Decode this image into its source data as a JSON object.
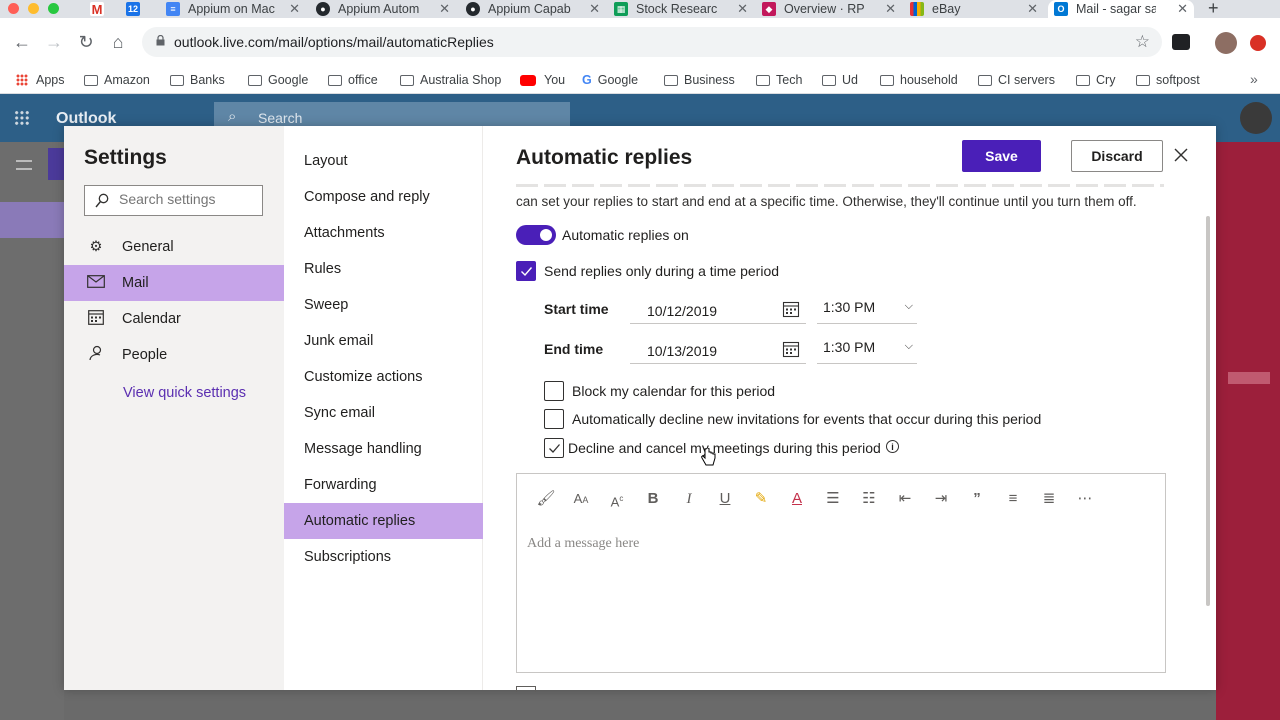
{
  "browser": {
    "tabs": [
      {
        "title": "",
        "icon": "gmail-icon"
      },
      {
        "title": "",
        "icon": "calendar-12-icon"
      },
      {
        "title": "Appium on Mac",
        "icon": "docs-icon"
      },
      {
        "title": "Appium Autom",
        "icon": "github-icon"
      },
      {
        "title": "Appium Capab",
        "icon": "github-icon"
      },
      {
        "title": "Stock Researc",
        "icon": "sheets-icon"
      },
      {
        "title": "Overview · RP",
        "icon": "rp-icon"
      },
      {
        "title": "eBay",
        "icon": "ebay-icon"
      },
      {
        "title": "Mail - sagar sa",
        "icon": "outlook-icon"
      }
    ],
    "url": "outlook.live.com/mail/options/mail/automaticReplies",
    "bookmarks": [
      "Apps",
      "Amazon",
      "Banks",
      "Google",
      "office",
      "Australia Shop",
      "You",
      "Google",
      "Business",
      "Tech",
      "Ud",
      "household",
      "CI servers",
      "Cry",
      "softpost"
    ]
  },
  "owa": {
    "brand": "Outlook",
    "search_placeholder": "Search"
  },
  "settings": {
    "title": "Settings",
    "search_placeholder": "Search settings",
    "categories": [
      {
        "label": "General",
        "icon": "gear-icon"
      },
      {
        "label": "Mail",
        "icon": "mail-icon"
      },
      {
        "label": "Calendar",
        "icon": "calendar-icon"
      },
      {
        "label": "People",
        "icon": "people-icon"
      }
    ],
    "view_quick": "View quick settings",
    "subitems": [
      "Layout",
      "Compose and reply",
      "Attachments",
      "Rules",
      "Sweep",
      "Junk email",
      "Customize actions",
      "Sync email",
      "Message handling",
      "Forwarding",
      "Automatic replies",
      "Subscriptions"
    ]
  },
  "auto": {
    "title": "Automatic replies",
    "save": "Save",
    "discard": "Discard",
    "description": "can set your replies to start and end at a specific time. Otherwise, they'll continue until you turn them off.",
    "toggle_label": "Automatic replies on",
    "toggle_on": true,
    "time_period_label": "Send replies only during a time period",
    "start_label": "Start time",
    "start_date": "10/12/2019",
    "start_time": "1:30 PM",
    "end_label": "End time",
    "end_date": "10/13/2019",
    "end_time": "1:30 PM",
    "block_calendar": "Block my calendar for this period",
    "decline_invites": "Automatically decline new invitations for events that occur during this period",
    "decline_cancel": "Decline and cancel my meetings during this period",
    "editor_placeholder": "Add a message here"
  },
  "colors": {
    "accent": "#4a1fb8",
    "selected_bg": "#c6a4e9",
    "owa_header": "#2d5f87"
  }
}
